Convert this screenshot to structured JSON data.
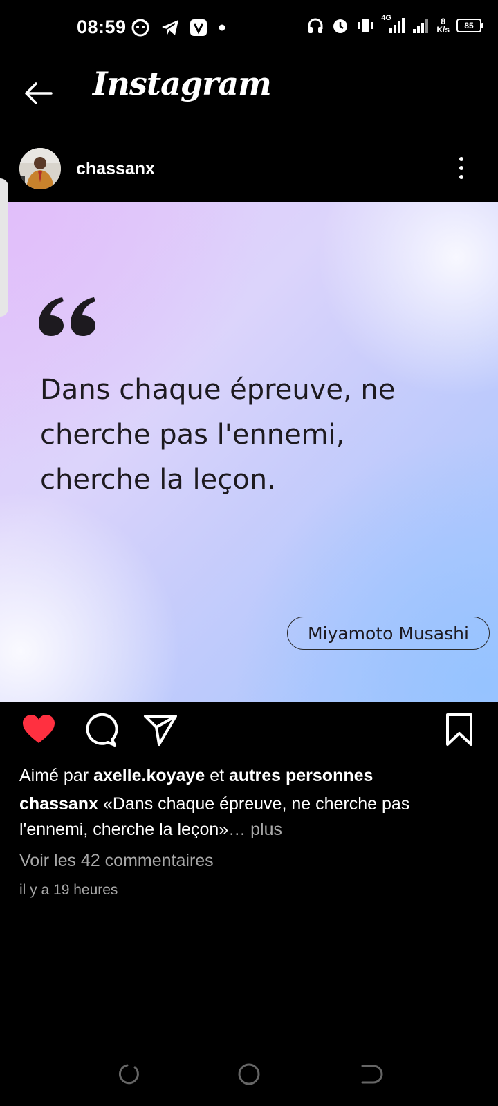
{
  "status_bar": {
    "time": "08:59",
    "network_speed_value": "8",
    "network_speed_unit": "K/s",
    "network_type": "4G",
    "battery": "85",
    "left_icons": [
      "face-app-icon",
      "telegram-icon",
      "v-app-icon",
      "notification-dot-icon"
    ],
    "right_icons": [
      "headphones-icon",
      "alarm-icon",
      "vibrate-icon",
      "signal-icon",
      "signal-icon",
      "battery-icon"
    ]
  },
  "header": {
    "title": "Instagram",
    "back_icon": "arrow-left-icon"
  },
  "post": {
    "username": "chassanx",
    "quote_lines": [
      "Dans chaque épreuve, ne",
      "cherche pas l'ennemi,",
      "cherche la leçon."
    ],
    "author": "Miyamoto Musashi",
    "liked": true,
    "likes_prefix": "Aimé par",
    "liked_by_user": "axelle.koyaye",
    "likes_join": "et",
    "likes_others": "autres personnes",
    "caption_username": "chassanx",
    "caption_text": "«Dans chaque épreuve, ne cherche pas l'ennemi, cherche la leçon»",
    "caption_ellipsis": "…",
    "caption_more": "plus",
    "comments_link": "Voir les 42 commentaires",
    "timestamp": "il y a 19 heures"
  },
  "colors": {
    "background": "#000000",
    "like_red": "#ff3040",
    "muted_text": "#a8a8a8",
    "quote_text": "#1d1a1f"
  }
}
